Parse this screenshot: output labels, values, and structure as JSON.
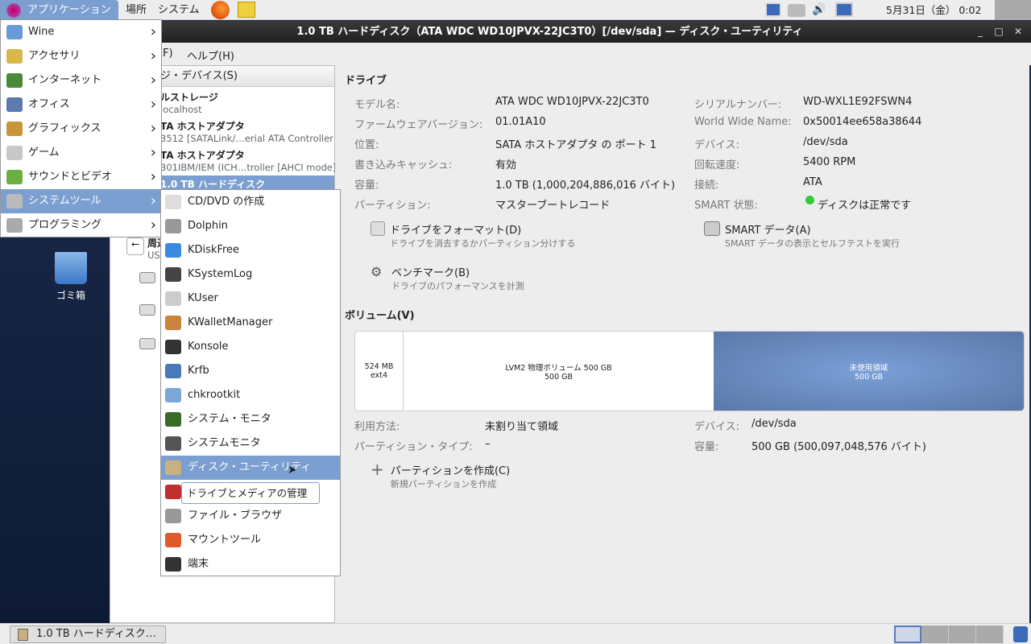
{
  "top_panel": {
    "applications": "アプリケーション",
    "places": "場所",
    "system": "システム",
    "clock": "5月31日（金） 0:02"
  },
  "window": {
    "title": "1.0 TB ハードディスク（ATA WDC WD10JPVX-22JC3T0）[/dev/sda] — ディスク・ユーティリティ",
    "minimize": "_",
    "maximize": "□",
    "close": "✕"
  },
  "menubar": {
    "file_partial": "F)",
    "help": "ヘルプ(H)"
  },
  "left_pane": {
    "header": "ジ・デバイス(S)",
    "items": [
      {
        "title": "ルストレージ",
        "sub": "localhost"
      },
      {
        "title": "TA ホストアダプタ",
        "sub": "3512 [SATALink/…erial ATA Controller"
      },
      {
        "title": "TA ホストアダプタ",
        "sub": "301IBM/IEM (ICH…troller [AHCI mode]"
      },
      {
        "title": "1.0 TB ハードディスク",
        "sub": ""
      },
      {
        "title": "周辺",
        "sub": "US"
      }
    ]
  },
  "desktop": {
    "trash": "ゴミ箱"
  },
  "drive": {
    "heading": "ドライブ",
    "left": [
      {
        "label": "モデル名:",
        "value": "ATA WDC WD10JPVX-22JC3T0"
      },
      {
        "label": "ファームウェアバージョン:",
        "value": "01.01A10"
      },
      {
        "label": "位置:",
        "value": "SATA ホストアダプタ の ポート 1"
      },
      {
        "label": "書き込みキャッシュ:",
        "value": "有効"
      },
      {
        "label": "容量:",
        "value": "1.0 TB (1,000,204,886,016 バイト)"
      },
      {
        "label": "パーティション:",
        "value": "マスターブートレコード"
      }
    ],
    "right": [
      {
        "label": "シリアルナンバー:",
        "value": "WD-WXL1E92FSWN4"
      },
      {
        "label": "World Wide Name:",
        "value": "0x50014ee658a38644"
      },
      {
        "label": "デバイス:",
        "value": "/dev/sda"
      },
      {
        "label": "回転速度:",
        "value": "5400 RPM"
      },
      {
        "label": "接続:",
        "value": "ATA"
      },
      {
        "label": "SMART 状態:",
        "value": "ディスクは正常です"
      }
    ],
    "actions": [
      {
        "title": "ドライブをフォーマット(D)",
        "desc": "ドライブを消去するかパーティション分けする"
      },
      {
        "title": "SMART データ(A)",
        "desc": "SMART データの表示とセルフテストを実行"
      },
      {
        "title": "ベンチマーク(B)",
        "desc": "ドライブのパフォーマンスを計測"
      }
    ]
  },
  "volumes": {
    "heading": "ボリューム(V)",
    "segments": [
      {
        "label": "524 MB ext4",
        "size": ""
      },
      {
        "label": "LVM2 物理ボリューム 500 GB",
        "size": "500 GB"
      },
      {
        "label": "未使用領域",
        "size": "500 GB"
      }
    ],
    "details": [
      {
        "label": "利用方法:",
        "value": "未割り当て領域"
      },
      {
        "label": "パーティション・タイプ:",
        "value": "–"
      },
      {
        "label": "デバイス:",
        "value": "/dev/sda"
      },
      {
        "label": "容量:",
        "value": "500 GB (500,097,048,576 バイト)"
      }
    ],
    "create": {
      "title": "パーティションを作成(C)",
      "desc": "新規パーティションを作成"
    }
  },
  "app_menu": [
    {
      "label": "Wine",
      "color": "#6a9ad8"
    },
    {
      "label": "アクセサリ",
      "color": "#d8b84a"
    },
    {
      "label": "インターネット",
      "color": "#4a8a3a"
    },
    {
      "label": "オフィス",
      "color": "#5a7ab0"
    },
    {
      "label": "グラフィックス",
      "color": "#c8963a"
    },
    {
      "label": "ゲーム",
      "color": "#c8c8c8"
    },
    {
      "label": "サウンドとビデオ",
      "color": "#6ab040"
    },
    {
      "label": "システムツール",
      "color": "#bbbbbb"
    },
    {
      "label": "プログラミング",
      "color": "#aaaaaa"
    }
  ],
  "system_tools": [
    {
      "label": "CD/DVD の作成",
      "color": "#ddd"
    },
    {
      "label": "Dolphin",
      "color": "#999"
    },
    {
      "label": "KDiskFree",
      "color": "#3a8ae0"
    },
    {
      "label": "KSystemLog",
      "color": "#444"
    },
    {
      "label": "KUser",
      "color": "#ccc"
    },
    {
      "label": "KWalletManager",
      "color": "#c8843a"
    },
    {
      "label": "Konsole",
      "color": "#333"
    },
    {
      "label": "Krfb",
      "color": "#4a78b8"
    },
    {
      "label": "chkrootkit",
      "color": "#7aa8d8"
    },
    {
      "label": "システム・モニタ",
      "color": "#3a6a2a"
    },
    {
      "label": "システムモニタ",
      "color": "#555"
    },
    {
      "label": "ディスク・ユーティリティ",
      "color": "#c8b080"
    },
    {
      "label": "ドライブとメディアの管理",
      "color": "#c03030"
    },
    {
      "label": "ファイル・ブラウザ",
      "color": "#999"
    },
    {
      "label": "マウントツール",
      "color": "#e05a2a"
    },
    {
      "label": "端末",
      "color": "#333"
    }
  ],
  "tooltip": "ドライブとメディアの管理",
  "taskbar": {
    "task": "1.0 TB ハードディスク…"
  }
}
